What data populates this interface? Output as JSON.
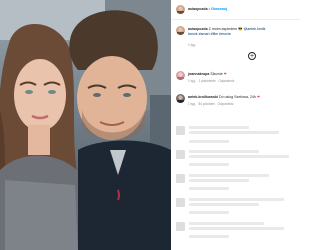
{
  "header": {
    "username": "asiaopozda",
    "separator": "•",
    "follow_label": "Obserwuj"
  },
  "caption": {
    "username": "asiaopozda",
    "text_1": "Z moim aspiedem",
    "mention": "@antek.krolik",
    "hashtags": "#work #smart #film #movie",
    "time": "1 tyg."
  },
  "comments": [
    {
      "username": "joannakrupa",
      "text": "Ślicznie",
      "heart": "❤",
      "time": "1 tyg.",
      "likes": "1 polubienie",
      "reply": "Odpowiedz"
    },
    {
      "username": "antek.krolikowski",
      "text": "Do usług Szefowa, 24h",
      "heart": "❤",
      "time": "1 tyg.",
      "likes": "84 polubień",
      "reply": "Odpowiedz"
    }
  ],
  "icons": {
    "load_more": "plus-circle-icon"
  },
  "colors": {
    "follow": "#0095f6",
    "text": "#262626",
    "muted": "#8e8e8e",
    "heart": "#ed4956"
  }
}
